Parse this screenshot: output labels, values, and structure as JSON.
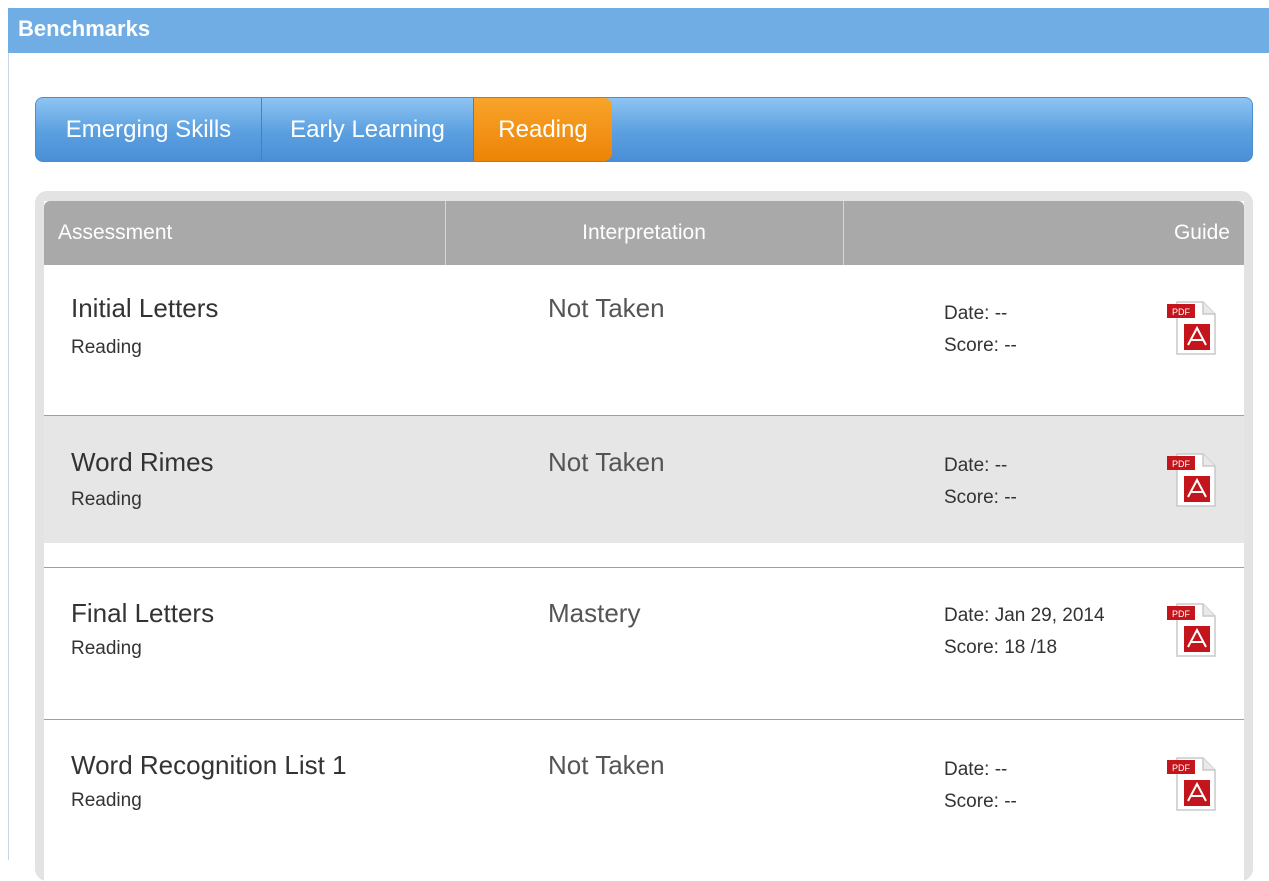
{
  "header": {
    "title": "Benchmarks"
  },
  "tabs": [
    {
      "label": "Emerging Skills"
    },
    {
      "label": "Early Learning"
    },
    {
      "label": "Reading"
    }
  ],
  "table": {
    "columns": {
      "assessment": "Assessment",
      "interpretation": "Interpretation",
      "guide": "Guide"
    },
    "rows": [
      {
        "name": "Initial Letters",
        "category": "Reading",
        "interpretation": "Not Taken",
        "date": "Date: --",
        "score": "Score: --"
      },
      {
        "name": "Word Rimes",
        "category": "Reading",
        "interpretation": "Not Taken",
        "date": "Date: --",
        "score": "Score: --"
      },
      {
        "name": "Final Letters",
        "category": "Reading",
        "interpretation": "Mastery",
        "date": "Date: Jan 29, 2014",
        "score": "Score: 18 /18"
      },
      {
        "name": "Word Recognition List 1",
        "category": "Reading",
        "interpretation": "Not Taken",
        "date": "Date: --",
        "score": "Score: --"
      }
    ]
  },
  "icons": {
    "guide": "pdf-icon",
    "pdf_badge": "PDF"
  },
  "colors": {
    "header": "#70ade4",
    "tab_active": "#f08a0c",
    "tab_bar": "#5a9fe0",
    "table_header": "#a9a9a9"
  }
}
